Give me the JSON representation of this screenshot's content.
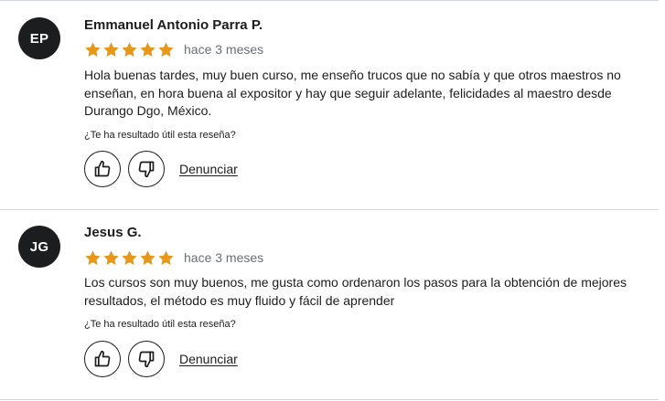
{
  "reviews": [
    {
      "initials": "EP",
      "name": "Emmanuel Antonio Parra P.",
      "rating": 5,
      "date": "hace 3 meses",
      "text": "Hola buenas tardes, muy buen curso, me enseño trucos que no sabía y que otros maestros no enseñan, en hora buena al expositor y hay que seguir adelante, felicidades al maestro desde Durango Dgo, México.",
      "helpful_question": "¿Te ha resultado útil esta reseña?",
      "report_label": "Denunciar"
    },
    {
      "initials": "JG",
      "name": "Jesus G.",
      "rating": 5,
      "date": "hace 3 meses",
      "text": "Los cursos son muy buenos, me gusta como ordenaron los pasos para la obtención de mejores resultados, el método es muy fluido y fácil de aprender",
      "helpful_question": "¿Te ha resultado útil esta reseña?",
      "report_label": "Denunciar"
    }
  ],
  "colors": {
    "star": "#e59819",
    "avatar_bg": "#1c1d1f",
    "muted_text": "#6a6f73",
    "divider": "#d1d7dc"
  },
  "icons": {
    "star": "star-icon",
    "like": "thumbs-up-icon",
    "dislike": "thumbs-down-icon"
  }
}
